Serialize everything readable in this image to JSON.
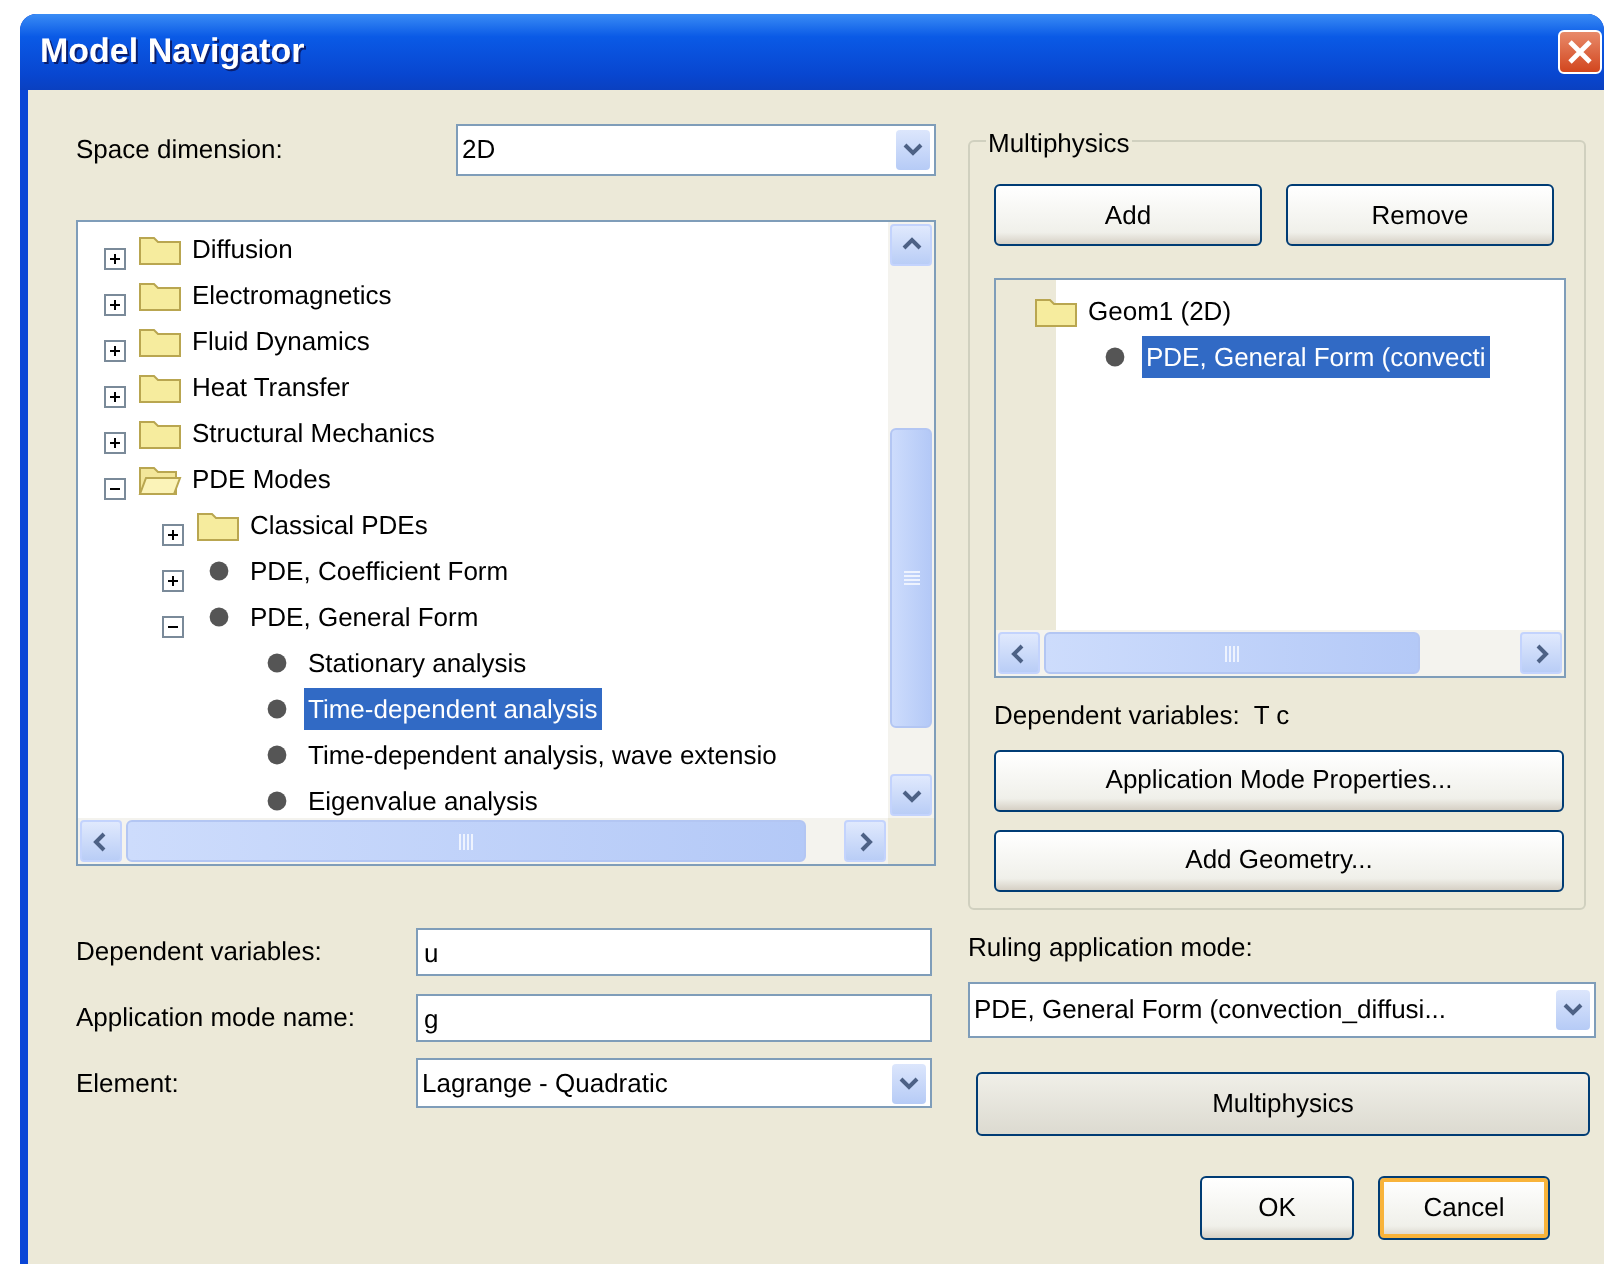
{
  "window": {
    "title": "Model Navigator"
  },
  "space_dimension": {
    "label": "Space dimension:",
    "value": "2D"
  },
  "application_modes": [
    {
      "label": "Diffusion",
      "kind": "folder",
      "expanded": false,
      "selected": false
    },
    {
      "label": "Electromagnetics",
      "kind": "folder",
      "expanded": false,
      "selected": false
    },
    {
      "label": "Fluid Dynamics",
      "kind": "folder",
      "expanded": false,
      "selected": false
    },
    {
      "label": "Heat Transfer",
      "kind": "folder",
      "expanded": false,
      "selected": false
    },
    {
      "label": "Structural Mechanics",
      "kind": "folder",
      "expanded": false,
      "selected": false
    },
    {
      "label": "PDE Modes",
      "kind": "folder",
      "expanded": true,
      "selected": false,
      "children": [
        {
          "label": "Classical PDEs",
          "kind": "folder",
          "expanded": false,
          "selected": false
        },
        {
          "label": "PDE, Coefficient Form",
          "kind": "mode",
          "expanded": false,
          "selected": false
        },
        {
          "label": "PDE, General Form",
          "kind": "mode",
          "expanded": true,
          "selected": false,
          "children": [
            {
              "label": "Stationary analysis",
              "kind": "mode",
              "selected": false
            },
            {
              "label": "Time-dependent analysis",
              "kind": "mode",
              "selected": true
            },
            {
              "label": "Time-dependent analysis, wave extensio",
              "kind": "mode",
              "selected": false
            },
            {
              "label": "Eigenvalue analysis",
              "kind": "mode",
              "selected": false
            }
          ]
        }
      ]
    }
  ],
  "dependent_variables": {
    "label": "Dependent variables:",
    "value": "u"
  },
  "application_mode_name": {
    "label": "Application mode name:",
    "value": "g"
  },
  "element": {
    "label": "Element:",
    "value": "Lagrange - Quadratic"
  },
  "multiphysics": {
    "title": "Multiphysics",
    "buttons": [
      "Add",
      "Remove"
    ],
    "tree": [
      {
        "label": "Geom1 (2D)",
        "kind": "folder",
        "selected": false,
        "children": [
          {
            "label": "PDE, General Form (convecti",
            "kind": "mode",
            "selected": true
          }
        ]
      }
    ],
    "dependent_variables": "Dependent variables:  T c",
    "lower_buttons": [
      "Application Mode Properties...",
      "Add Geometry..."
    ]
  },
  "ruling_application_mode": {
    "label": "Ruling application mode:",
    "value": "PDE, General Form (convection_diffusi..."
  },
  "multiphysics_button": "Multiphysics",
  "buttons": [
    {
      "label": "OK",
      "focused": false
    },
    {
      "label": "Cancel",
      "focused": true
    }
  ]
}
